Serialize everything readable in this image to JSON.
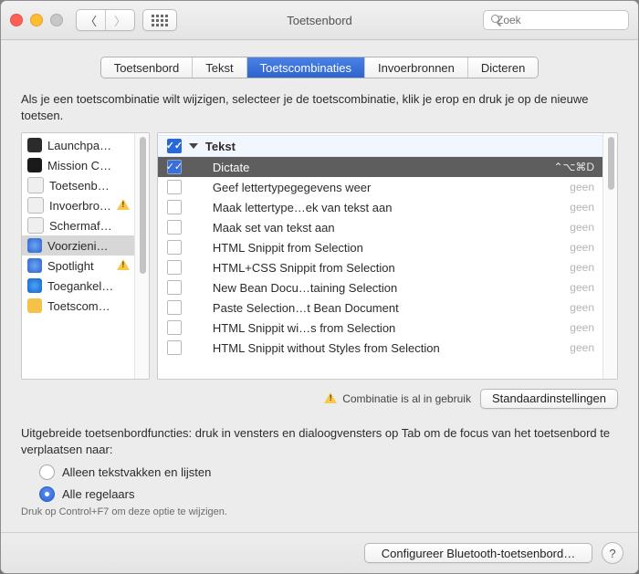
{
  "window": {
    "title": "Toetsenbord"
  },
  "search": {
    "placeholder": "Zoek"
  },
  "tabs": [
    {
      "label": "Toetsenbord"
    },
    {
      "label": "Tekst"
    },
    {
      "label": "Toetscombinaties",
      "active": true
    },
    {
      "label": "Invoerbronnen"
    },
    {
      "label": "Dicteren"
    }
  ],
  "hint": "Als je een toetscombinatie wilt wijzigen, selecteer je de toetscombinatie, klik je erop en druk je op de nieuwe toetsen.",
  "sidebar": {
    "items": [
      {
        "label": "Launchpa…",
        "icon": "launchpad",
        "warn": false
      },
      {
        "label": "Mission C…",
        "icon": "mission",
        "warn": false
      },
      {
        "label": "Toetsenb…",
        "icon": "keyboard",
        "warn": false
      },
      {
        "label": "Invoerbro…",
        "icon": "input",
        "warn": true
      },
      {
        "label": "Schermaf…",
        "icon": "screenshot",
        "warn": false
      },
      {
        "label": "Voorzieni…",
        "icon": "services",
        "warn": false,
        "selected": true
      },
      {
        "label": "Spotlight",
        "icon": "spotlight",
        "warn": true
      },
      {
        "label": "Toegankel…",
        "icon": "accessibility",
        "warn": false
      },
      {
        "label": "Toetscom…",
        "icon": "appshortcuts",
        "warn": false
      }
    ]
  },
  "main": {
    "header": {
      "label": "Tekst"
    },
    "rows": [
      {
        "checked": true,
        "label": "Dictate",
        "shortcut": "⌃⌥⌘D",
        "selected": true
      },
      {
        "checked": false,
        "label": "Geef lettertypegegevens weer",
        "shortcut": "geen"
      },
      {
        "checked": false,
        "label": "Maak lettertype…ek van tekst aan",
        "shortcut": "geen"
      },
      {
        "checked": false,
        "label": "Maak set van tekst aan",
        "shortcut": "geen"
      },
      {
        "checked": false,
        "label": "HTML Snippit from Selection",
        "shortcut": "geen"
      },
      {
        "checked": false,
        "label": "HTML+CSS Snippit from Selection",
        "shortcut": "geen"
      },
      {
        "checked": false,
        "label": "New Bean Docu…taining Selection",
        "shortcut": "geen"
      },
      {
        "checked": false,
        "label": "Paste Selection…t Bean Document",
        "shortcut": "geen"
      },
      {
        "checked": false,
        "label": "HTML Snippit wi…s from Selection",
        "shortcut": "geen"
      },
      {
        "checked": false,
        "label": "HTML Snippit without Styles from Selection",
        "shortcut": "geen"
      }
    ]
  },
  "status": {
    "in_use": "Combinatie is al in gebruik"
  },
  "buttons": {
    "restore_defaults": "Standaardinstellingen",
    "configure_bt": "Configureer Bluetooth-toetsenbord…"
  },
  "extended": {
    "intro": "Uitgebreide toetsenbordfuncties: druk in vensters en dialoogvensters op Tab om de focus van het toetsenbord te verplaatsen naar:",
    "opt1": "Alleen tekstvakken en lijsten",
    "opt2": "Alle regelaars",
    "note": "Druk op Control+F7 om deze optie te wijzigen."
  }
}
